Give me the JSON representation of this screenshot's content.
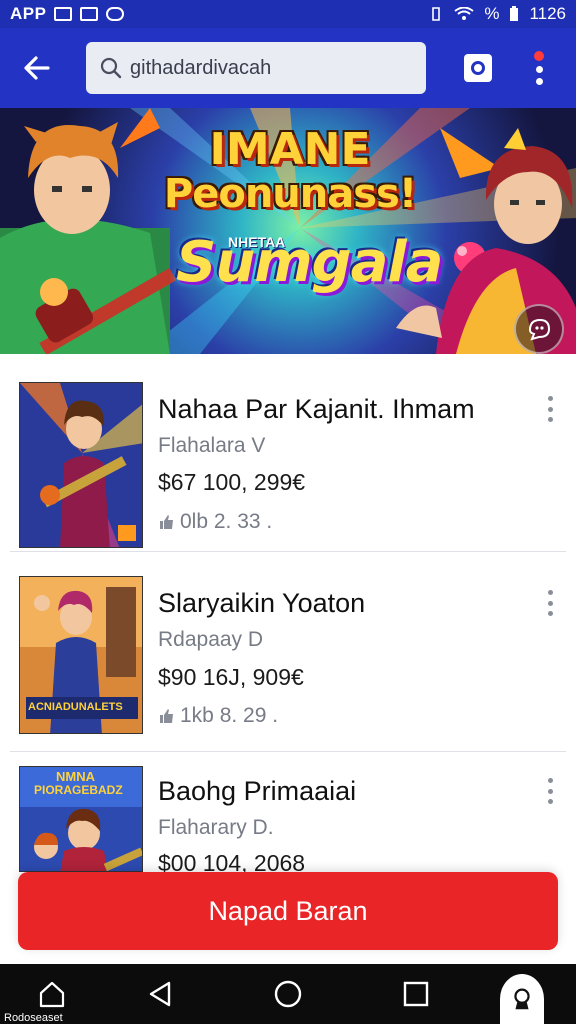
{
  "status_bar": {
    "app_label": "APP",
    "battery": "%",
    "time": "1126"
  },
  "header": {
    "search_value": "githadardivacah"
  },
  "banner": {
    "title_line1": "IMANE",
    "title_line2": "Peonunass!",
    "subtitle_small": "NHETAA",
    "logo_text": "Sumgala"
  },
  "list": {
    "items": [
      {
        "title": "Nahaa Par Kajanit. Ihmam",
        "subtitle": "Flahalara V",
        "price": "$67 100, 299€",
        "meta": "0lb 2. 33 ."
      },
      {
        "title": "Slaryaikin Yoaton",
        "subtitle": "Rdapaay D",
        "price": "$90 16J, 909€",
        "meta": "1kb 8. 29 ."
      },
      {
        "title": "Baohg Primaaiai",
        "subtitle": "Flaharary D.",
        "price": "$00 104, 2068",
        "meta": ""
      }
    ],
    "thumb_texts": {
      "item3_top": "NMNA",
      "item3_sub": "PIORAGEBADZ",
      "item2_caption": "ACNIADUNALETS"
    }
  },
  "cta": {
    "label": "Napad Baran"
  },
  "nav": {
    "home_label": "Rodoseaset"
  },
  "colors": {
    "header_blue": "#2333c4",
    "cta_red": "#ea2528",
    "nav_black": "#0c0c0c"
  }
}
